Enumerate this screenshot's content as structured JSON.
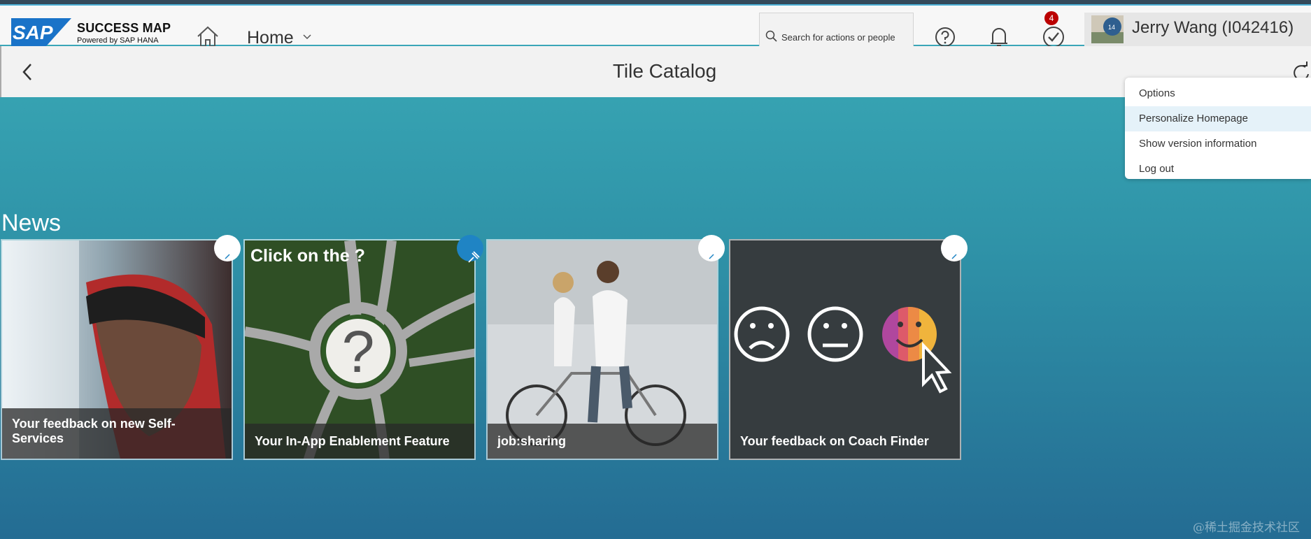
{
  "shell": {
    "brand_title": "SUCCESS MAP",
    "brand_subtitle": "Powered by SAP HANA",
    "home_label": "Home",
    "search_placeholder": "Search for actions or people",
    "notification_badge": "4",
    "user_name": "Jerry Wang (I042416)"
  },
  "page": {
    "title": "Tile Catalog"
  },
  "user_menu": {
    "items": [
      {
        "label": "Options",
        "highlighted": false
      },
      {
        "label": "Personalize Homepage",
        "highlighted": true
      },
      {
        "label": "Show version information",
        "highlighted": false
      },
      {
        "label": "Log out",
        "highlighted": false
      }
    ]
  },
  "catalog": {
    "section_title": "News",
    "tiles": [
      {
        "title": "Your feedback on new Self-Services",
        "pinned": false
      },
      {
        "title": "Your In-App Enablement Feature",
        "overlay_text": "Click on the ?",
        "pinned": true
      },
      {
        "title": "job:sharing",
        "pinned": false
      },
      {
        "title": "Your feedback on Coach Finder",
        "pinned": false
      }
    ]
  },
  "watermark": "@稀土掘金技术社区",
  "colors": {
    "accent": "#3aa6b8",
    "pin_active": "#1f84c4",
    "badge": "#bb0000"
  },
  "icons": [
    "sap-logo",
    "home-icon",
    "chevron-down-icon",
    "search-icon",
    "help-icon",
    "bell-icon",
    "checkmark-icon",
    "back-icon",
    "refresh-icon",
    "pin-icon"
  ]
}
